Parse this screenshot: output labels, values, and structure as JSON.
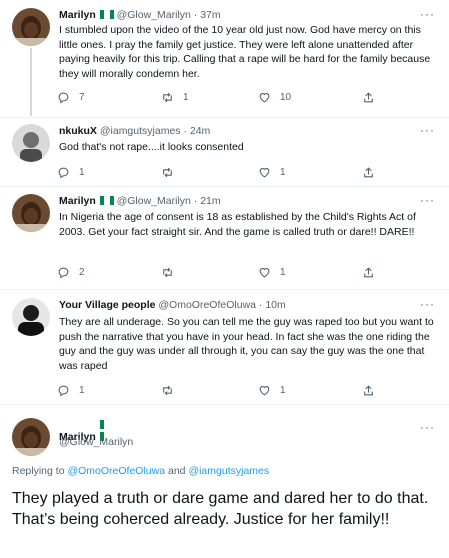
{
  "flag_colors": [
    "#008751",
    "#ffffff",
    "#008751"
  ],
  "accent_color": "#1d9bf0",
  "tweets": [
    {
      "name": "Marilyn",
      "meta": "@Glow_Marilyn · 37m",
      "text": "I stumbled upon the video of the 10 year old just now.  God have mercy on this little ones. I pray the family get justice. They were left alone unattended after paying heavily for this trip. Calling that a rape will be hard for the family because they will morally condemn her.",
      "replies": "7",
      "retweets": "1",
      "likes": "10"
    },
    {
      "name": "nkukuX",
      "meta": "@iamgutsyjames · 24m",
      "text": "God that's not rape....it looks consented",
      "replies": "1",
      "retweets": "",
      "likes": "1"
    },
    {
      "name": "Marilyn",
      "meta": "@Glow_Marilyn · 21m",
      "text": "In Nigeria the age of consent is 18 as established by the Child's Rights Act of 2003. Get your fact straight sir. And the game is called truth or dare!! DARE!!",
      "replies": "2",
      "retweets": "",
      "likes": "1"
    },
    {
      "name": "Your Village people",
      "meta": "@OmoOreOfeOluwa · 10m",
      "text": "They are all underage. So you can tell me the guy was raped too but you want to push the narrative that you have in your head. In fact she was the one riding the guy and the guy was under all through it, you can say the guy was the one that was raped",
      "replies": "1",
      "retweets": "",
      "likes": "1"
    }
  ],
  "main_tweet": {
    "name": "Marilyn",
    "handle": "@Glow_Marilyn",
    "replying_prefix": "Replying to",
    "replying_user1": "@OmoOreOfeOluwa",
    "replying_and": "and",
    "replying_user2": "@iamgutsyjames",
    "text": "They played a truth or dare game and dared her to do that. That’s being coherced already. Justice for her family!!"
  },
  "more_label": "···"
}
